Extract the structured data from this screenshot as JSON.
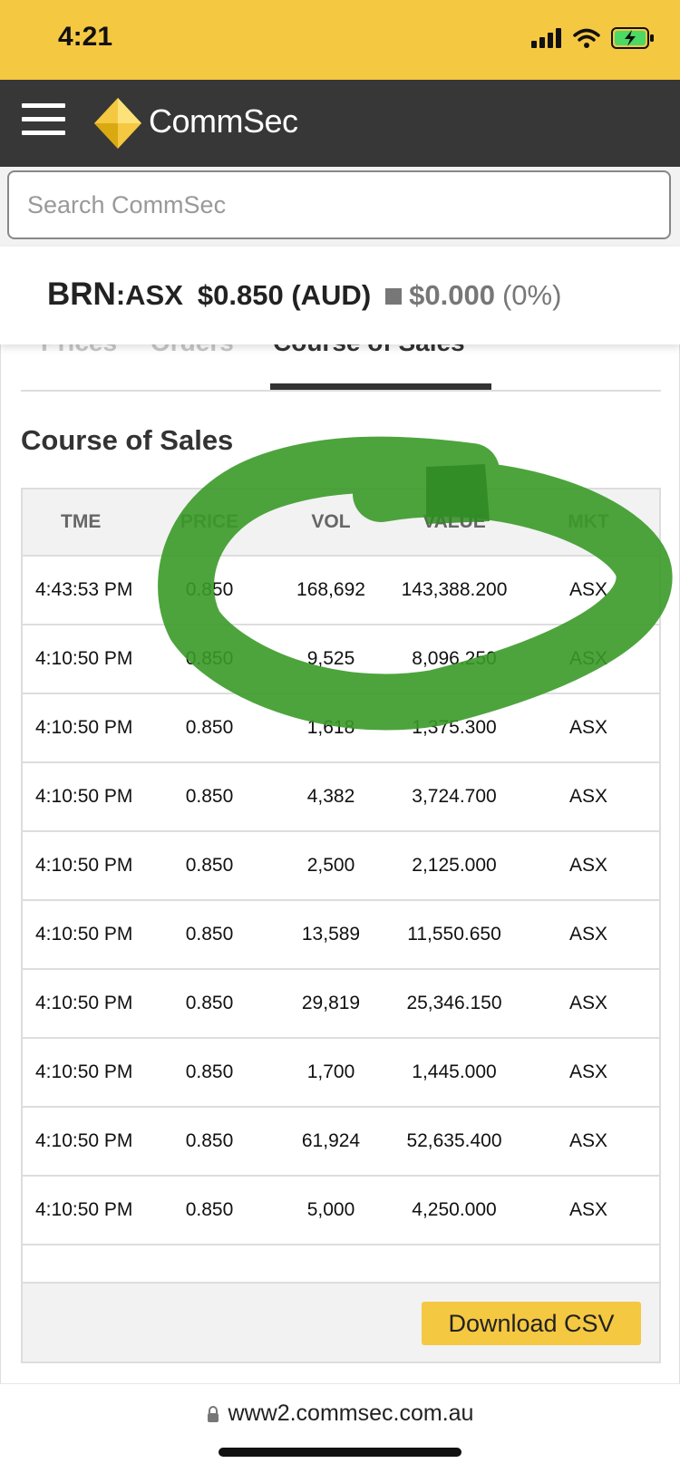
{
  "status_bar": {
    "time": "4:21"
  },
  "header": {
    "brand": "CommSec",
    "accent": "#f5c842"
  },
  "search": {
    "placeholder": "Search CommSec"
  },
  "quote": {
    "code": "BRN",
    "exchange": ":ASX",
    "price": "$0.850 (AUD)",
    "change": "$0.000",
    "change_pct": "(0%)"
  },
  "tabs": [
    {
      "label": "Prices"
    },
    {
      "label": "Orders"
    },
    {
      "label": "Course of Sales",
      "active": true
    }
  ],
  "section_title": "Course of Sales",
  "table": {
    "columns": [
      "TME",
      "PRICE",
      "VOL",
      "VALUE",
      "MKT"
    ],
    "rows": [
      [
        "4:43:53 PM",
        "0.850",
        "168,692",
        "143,388.200",
        "ASX"
      ],
      [
        "4:10:50 PM",
        "0.850",
        "9,525",
        "8,096.250",
        "ASX"
      ],
      [
        "4:10:50 PM",
        "0.850",
        "1,618",
        "1,375.300",
        "ASX"
      ],
      [
        "4:10:50 PM",
        "0.850",
        "4,382",
        "3,724.700",
        "ASX"
      ],
      [
        "4:10:50 PM",
        "0.850",
        "2,500",
        "2,125.000",
        "ASX"
      ],
      [
        "4:10:50 PM",
        "0.850",
        "13,589",
        "11,550.650",
        "ASX"
      ],
      [
        "4:10:50 PM",
        "0.850",
        "29,819",
        "25,346.150",
        "ASX"
      ],
      [
        "4:10:50 PM",
        "0.850",
        "1,700",
        "1,445.000",
        "ASX"
      ],
      [
        "4:10:50 PM",
        "0.850",
        "61,924",
        "52,635.400",
        "ASX"
      ],
      [
        "4:10:50 PM",
        "0.850",
        "5,000",
        "4,250.000",
        "ASX"
      ]
    ]
  },
  "download_button": "Download CSV",
  "url": "www2.commsec.com.au",
  "annotation_color": "#3a9a28"
}
